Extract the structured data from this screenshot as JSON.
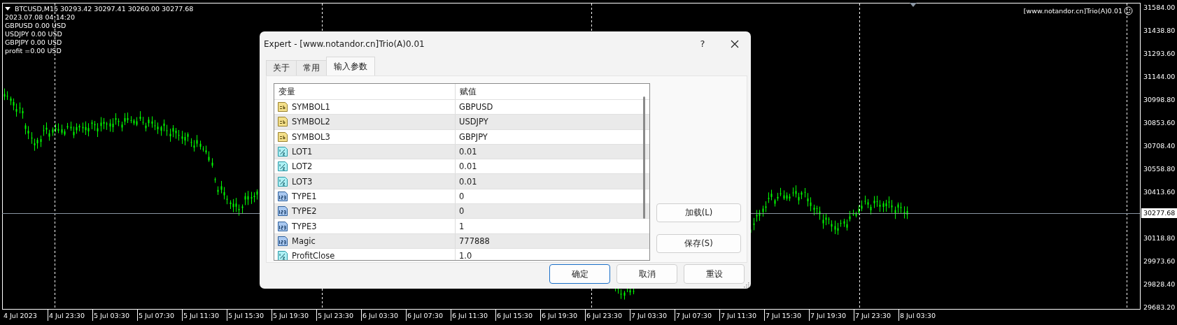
{
  "chart": {
    "symbol_line": "BTCUSD,M15  30293.42 30297.41 30260.00 30277.68",
    "info_lines": [
      "2023.07.08 04:14:20",
      "GBPUSD 0.00 USD",
      "USDJPY 0.00 USD",
      "GBPJPY 0.00 USD",
      "profit =0.00 USD"
    ],
    "expert_label": "[www.notandor.cn]Trio(A)0.01",
    "price_ticks": [
      "31584.00",
      "31438.80",
      "31293.60",
      "31144.00",
      "30998.80",
      "30853.60",
      "30708.40",
      "30558.80",
      "30413.60",
      "30118.80",
      "29973.60",
      "29828.40",
      "29683.20"
    ],
    "current_price": "30277.68",
    "time_ticks": [
      "4 Jul 2023",
      "4 Jul 23:30",
      "5 Jul 03:30",
      "5 Jul 07:30",
      "5 Jul 11:30",
      "5 Jul 15:30",
      "5 Jul 19:30",
      "5 Jul 23:30",
      "6 Jul 03:30",
      "6 Jul 07:30",
      "6 Jul 11:30",
      "6 Jul 15:30",
      "6 Jul 19:30",
      "6 Jul 23:30",
      "7 Jul 03:30",
      "7 Jul 07:30",
      "7 Jul 11:30",
      "7 Jul 15:30",
      "7 Jul 19:30",
      "7 Jul 23:30",
      "8 Jul 03:30"
    ]
  },
  "dialog": {
    "title": "Expert - [www.notandor.cn]Trio(A)0.01",
    "help": "?",
    "tabs": [
      {
        "label": "关于",
        "selected": false
      },
      {
        "label": "常用",
        "selected": false
      },
      {
        "label": "输入参数",
        "selected": true
      }
    ],
    "table": {
      "columns": [
        "变量",
        "赋值"
      ],
      "rows": [
        {
          "kind": "string",
          "name": "SYMBOL1",
          "value": "GBPUSD"
        },
        {
          "kind": "string",
          "name": "SYMBOL2",
          "value": "USDJPY"
        },
        {
          "kind": "string",
          "name": "SYMBOL3",
          "value": "GBPJPY"
        },
        {
          "kind": "double",
          "name": "LOT1",
          "value": "0.01"
        },
        {
          "kind": "double",
          "name": "LOT2",
          "value": "0.01"
        },
        {
          "kind": "double",
          "name": "LOT3",
          "value": "0.01"
        },
        {
          "kind": "int",
          "name": "TYPE1",
          "value": "0"
        },
        {
          "kind": "int",
          "name": "TYPE2",
          "value": "0"
        },
        {
          "kind": "int",
          "name": "TYPE3",
          "value": "1"
        },
        {
          "kind": "int",
          "name": "Magic",
          "value": "777888"
        },
        {
          "kind": "double",
          "name": "ProfitClose",
          "value": "1.0"
        }
      ]
    },
    "side_buttons": [
      "加载(L)",
      "保存(S)"
    ],
    "buttons": [
      {
        "label": "确定",
        "default": true
      },
      {
        "label": "取消",
        "default": false
      },
      {
        "label": "重设",
        "default": false
      }
    ]
  }
}
